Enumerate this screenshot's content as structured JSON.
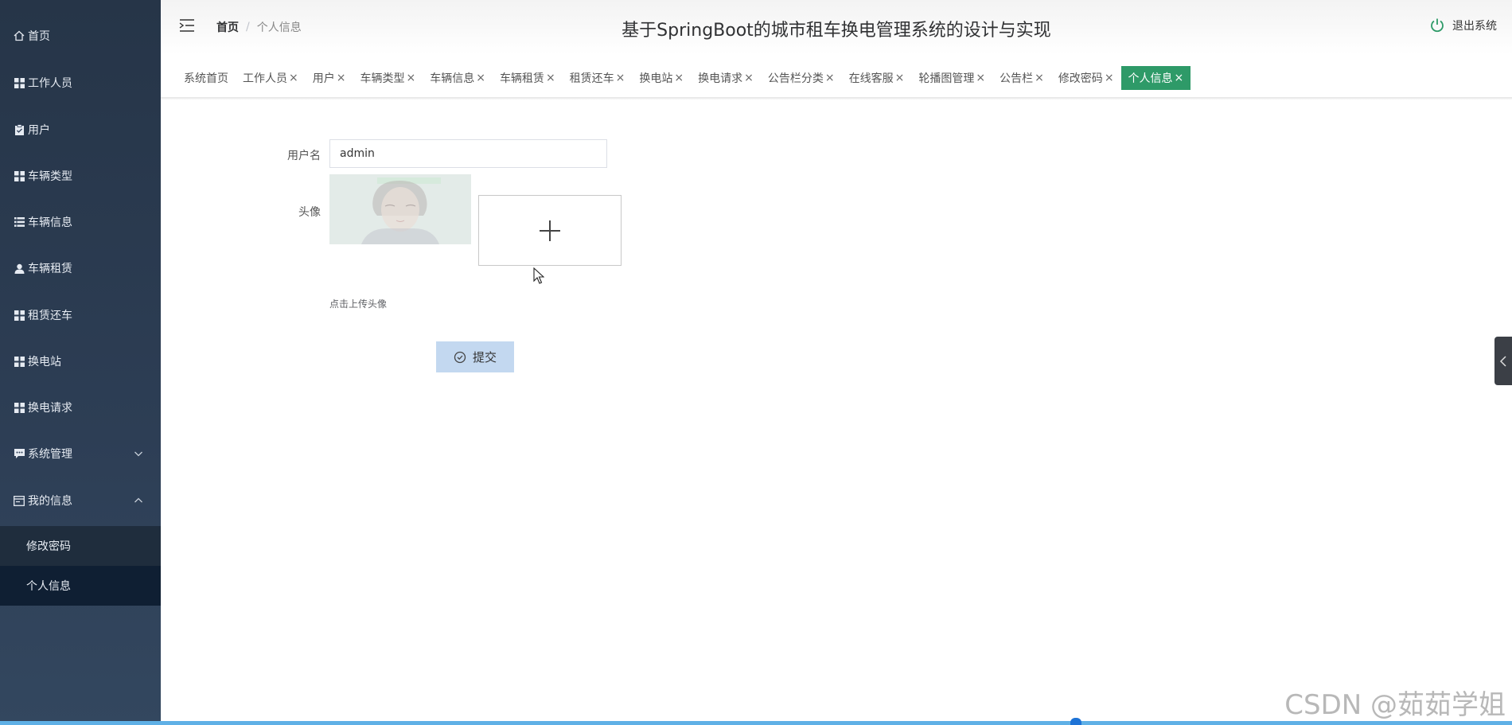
{
  "sidebar": {
    "items": [
      {
        "label": "首页",
        "icon": "home-icon"
      },
      {
        "label": "工作人员",
        "icon": "grid-icon"
      },
      {
        "label": "用户",
        "icon": "clipboard-icon"
      },
      {
        "label": "车辆类型",
        "icon": "grid-icon"
      },
      {
        "label": "车辆信息",
        "icon": "list-icon"
      },
      {
        "label": "车辆租赁",
        "icon": "user-icon"
      },
      {
        "label": "租赁还车",
        "icon": "grid-icon"
      },
      {
        "label": "换电站",
        "icon": "grid-icon"
      },
      {
        "label": "换电请求",
        "icon": "grid-icon"
      },
      {
        "label": "系统管理",
        "icon": "chat-icon"
      },
      {
        "label": "我的信息",
        "icon": "card-icon"
      }
    ],
    "submenu": [
      {
        "label": "修改密码"
      },
      {
        "label": "个人信息"
      }
    ]
  },
  "header": {
    "breadcrumb_home": "首页",
    "breadcrumb_separator": "/",
    "breadcrumb_current": "个人信息",
    "title": "基于SpringBoot的城市租车换电管理系统的设计与实现",
    "logout_label": "退出系统"
  },
  "tabs": [
    {
      "label": "系统首页",
      "closable": false
    },
    {
      "label": "工作人员",
      "closable": true
    },
    {
      "label": "用户",
      "closable": true
    },
    {
      "label": "车辆类型",
      "closable": true
    },
    {
      "label": "车辆信息",
      "closable": true
    },
    {
      "label": "车辆租赁",
      "closable": true
    },
    {
      "label": "租赁还车",
      "closable": true
    },
    {
      "label": "换电站",
      "closable": true
    },
    {
      "label": "换电请求",
      "closable": true
    },
    {
      "label": "公告栏分类",
      "closable": true
    },
    {
      "label": "在线客服",
      "closable": true
    },
    {
      "label": "轮播图管理",
      "closable": true
    },
    {
      "label": "公告栏",
      "closable": true
    },
    {
      "label": "修改密码",
      "closable": true
    },
    {
      "label": "个人信息",
      "closable": true,
      "active": true
    }
  ],
  "tab_close_glyph": "×",
  "form": {
    "username_label": "用户名",
    "username_value": "admin",
    "avatar_label": "头像",
    "upload_hint": "点击上传头像",
    "submit_label": "提交"
  },
  "watermark": "CSDN @茹茹学姐",
  "colors": {
    "sidebar_bg": "#2d3e55",
    "active_tab": "#2e9a68",
    "submit_bg": "#c3d8f0",
    "power_icon": "#2e9a68"
  }
}
